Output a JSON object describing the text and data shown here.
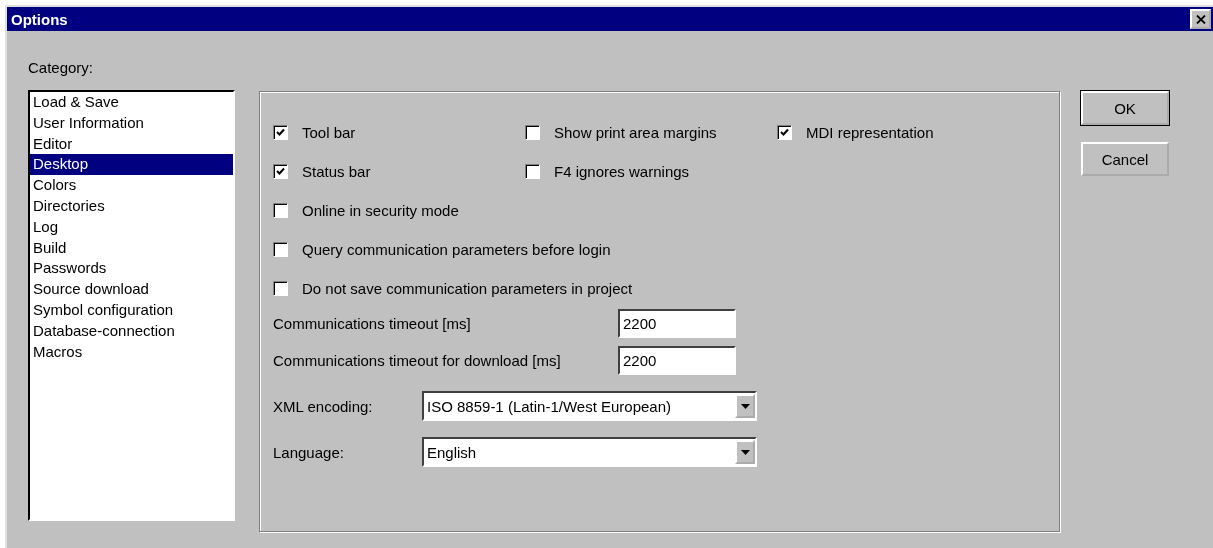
{
  "window": {
    "title": "Options"
  },
  "category": {
    "label": "Category:",
    "items": [
      {
        "label": "Load & Save",
        "selected": false
      },
      {
        "label": "User Information",
        "selected": false
      },
      {
        "label": "Editor",
        "selected": false
      },
      {
        "label": "Desktop",
        "selected": true
      },
      {
        "label": "Colors",
        "selected": false
      },
      {
        "label": "Directories",
        "selected": false
      },
      {
        "label": "Log",
        "selected": false
      },
      {
        "label": "Build",
        "selected": false
      },
      {
        "label": "Passwords",
        "selected": false
      },
      {
        "label": "Source download",
        "selected": false
      },
      {
        "label": "Symbol configuration",
        "selected": false
      },
      {
        "label": "Database-connection",
        "selected": false
      },
      {
        "label": "Macros",
        "selected": false
      }
    ]
  },
  "checkbox_rows": [
    [
      {
        "label": "Tool bar",
        "checked": true
      },
      {
        "label": "Show print area margins",
        "checked": false
      },
      {
        "label": "MDI representation",
        "checked": true
      }
    ],
    [
      {
        "label": "Status bar",
        "checked": true
      },
      {
        "label": "F4 ignores warnings",
        "checked": false
      }
    ],
    [
      {
        "label": "Online in security mode",
        "checked": false
      }
    ],
    [
      {
        "label": "Query communication parameters before login",
        "checked": false
      }
    ],
    [
      {
        "label": "Do not save communication parameters in project",
        "checked": false
      }
    ]
  ],
  "timeouts": [
    {
      "label": "Communications timeout [ms]",
      "value": "2200"
    },
    {
      "label": "Communications timeout for download [ms]",
      "value": "2200"
    }
  ],
  "dropdowns": [
    {
      "label": "XML encoding:",
      "value": "ISO 8859-1 (Latin-1/West European)"
    },
    {
      "label": "Language:",
      "value": "English"
    }
  ],
  "buttons": [
    {
      "label": "OK",
      "default": true
    },
    {
      "label": "Cancel",
      "default": false
    }
  ]
}
